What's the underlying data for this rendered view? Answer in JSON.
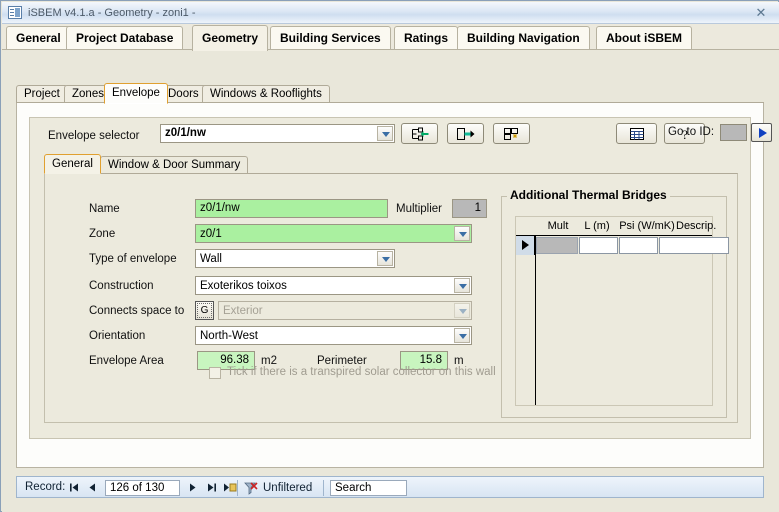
{
  "window": {
    "title": "iSBEM v4.1.a - Geometry - zoni1 -",
    "close_label": "✕",
    "icon": "app-window-icon"
  },
  "ribbon": {
    "tabs": [
      {
        "label": "General",
        "active": false
      },
      {
        "label": "Project Database",
        "active": false
      },
      {
        "label": "Geometry",
        "active": true
      },
      {
        "label": "Building Services",
        "active": false
      },
      {
        "label": "Ratings",
        "active": false
      },
      {
        "label": "Building Navigation",
        "active": false
      },
      {
        "label": "About iSBEM",
        "active": false
      }
    ]
  },
  "subtabs": {
    "tabs": [
      {
        "label": "Project",
        "active": false
      },
      {
        "label": "Zones",
        "active": false
      },
      {
        "label": "Envelope",
        "active": true
      },
      {
        "label": "Doors",
        "active": false
      },
      {
        "label": "Windows & Rooflights",
        "active": false
      }
    ]
  },
  "selector": {
    "label": "Envelope selector",
    "value": "z0/1/nw",
    "buttons": [
      {
        "name": "goto-first-icon"
      },
      {
        "name": "goto-next-icon"
      },
      {
        "name": "copy-record-icon"
      },
      {
        "name": "grid-view-icon"
      },
      {
        "name": "help-icon"
      }
    ]
  },
  "goto": {
    "label": "Go to ID:",
    "value": "",
    "button": "go-arrow-icon"
  },
  "general_tabs": {
    "tabs": [
      {
        "label": "General",
        "active": true
      },
      {
        "label": "Window & Door Summary",
        "active": false
      }
    ]
  },
  "form": {
    "name": {
      "label": "Name",
      "value": "z0/1/nw"
    },
    "multiplier": {
      "label": "Multiplier",
      "value": "1"
    },
    "zone": {
      "label": "Zone",
      "value": "z0/1"
    },
    "type_of_envelope": {
      "label": "Type of envelope",
      "value": "Wall"
    },
    "construction": {
      "label": "Construction",
      "value": "Exoterikos toixos"
    },
    "connects_space_to": {
      "label": "Connects space to",
      "button_label": "G",
      "value": "Exterior"
    },
    "orientation": {
      "label": "Orientation",
      "value": "North-West"
    },
    "envelope_area": {
      "label": "Envelope Area",
      "value": "96.38",
      "unit": "m2"
    },
    "perimeter": {
      "label": "Perimeter",
      "value": "15.8",
      "unit": "m"
    },
    "solar_collector": {
      "label": "Tick if there is a transpired solar collector on this wall",
      "checked": false
    }
  },
  "thermal_bridges": {
    "title": "Additional Thermal Bridges",
    "columns": [
      "Mult",
      "L (m)",
      "Psi (W/mK)",
      "Descrip."
    ],
    "rows": [
      {
        "mult": "",
        "length": "",
        "psi": "",
        "descrip": "",
        "selected": true
      }
    ]
  },
  "navbar": {
    "record_label": "Record:",
    "record_value": "126 of 130",
    "first_icon": "nav-first-icon",
    "prev_icon": "nav-prev-icon",
    "next_icon": "nav-next-icon",
    "last_icon": "nav-last-icon",
    "new_icon": "nav-new-record-icon",
    "filter_icon": "filter-icon",
    "filter_label": "Unfiltered",
    "search_value": "Search"
  },
  "colors": {
    "titlebar": "#dbe6f4",
    "panel": "#eceadd",
    "accent_tab": "#e0a030",
    "green_field": "#aaf0a0",
    "gray_field": "#b8b8b8"
  }
}
